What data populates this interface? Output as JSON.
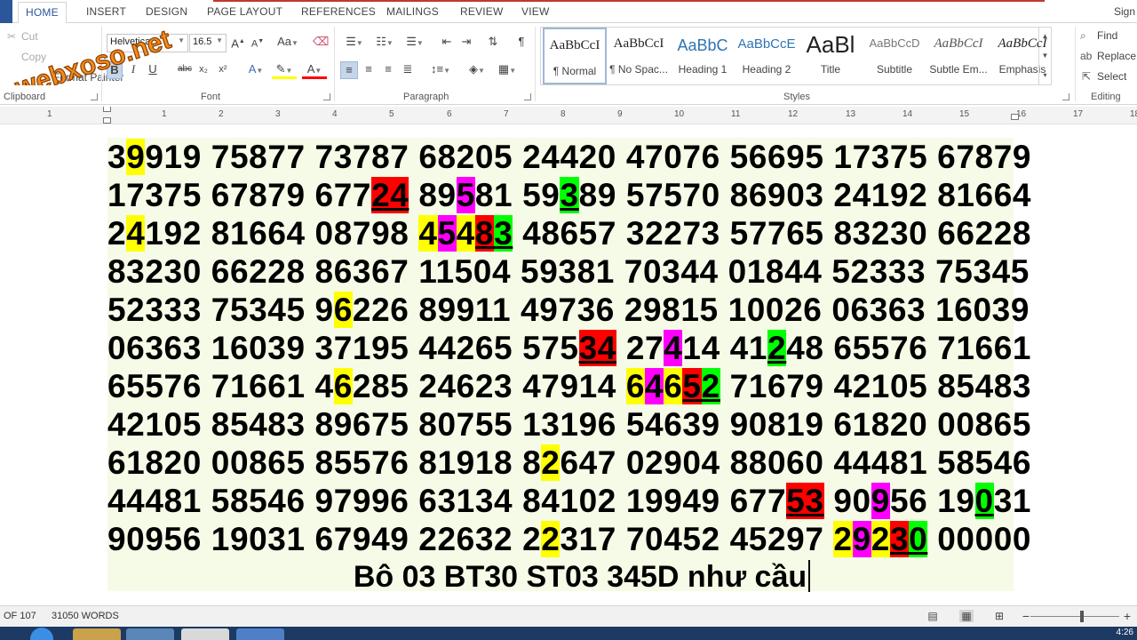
{
  "tabs": [
    "HOME",
    "INSERT",
    "DESIGN",
    "PAGE LAYOUT",
    "REFERENCES",
    "MAILINGS",
    "REVIEW",
    "VIEW"
  ],
  "signin": "Sign",
  "clipboard": {
    "cut": "Cut",
    "copy": "Copy",
    "format_painter": "Format Painter",
    "label": "Clipboard"
  },
  "font": {
    "name": "Helvetica",
    "size": "16.5",
    "label": "Font",
    "buttons": [
      "B",
      "I",
      "U",
      "abc",
      "x₂",
      "x²"
    ]
  },
  "paragraph": {
    "label": "Paragraph"
  },
  "styles": {
    "label": "Styles",
    "items": [
      {
        "preview": "AaBbCcI",
        "name": "¶ Normal"
      },
      {
        "preview": "AaBbCcI",
        "name": "¶ No Spac..."
      },
      {
        "preview": "AaBbC",
        "name": "Heading 1"
      },
      {
        "preview": "AaBbCcE",
        "name": "Heading 2"
      },
      {
        "preview": "AaBl",
        "name": "Title"
      },
      {
        "preview": "AaBbCcD",
        "name": "Subtitle"
      },
      {
        "preview": "AaBbCcI",
        "name": "Subtle Em..."
      },
      {
        "preview": "AaBbCcI",
        "name": "Emphasis"
      }
    ]
  },
  "editing": {
    "find": "Find",
    "replace": "Replace",
    "select": "Select",
    "label": "Editing"
  },
  "watermark": "webxoso.net",
  "ruler": [
    "1",
    "1",
    "2",
    "3",
    "4",
    "5",
    "6",
    "7",
    "8",
    "9",
    "10",
    "11",
    "12",
    "13",
    "14",
    "15",
    "16",
    "17",
    "18"
  ],
  "colors": {
    "yellow": "#ffff00",
    "red": "#ff0000",
    "magenta": "#ff00ff",
    "green": "#00ff00",
    "page": "#f5fbe6",
    "accent": "#2b579a"
  },
  "rows": [
    [
      [
        [
          "3",
          ""
        ],
        [
          "9",
          "y"
        ],
        [
          "919 75877 73787 68205 24420 47076 56695 17375 67879",
          ""
        ]
      ]
    ],
    [
      [
        [
          "17375 67879 677",
          ""
        ],
        [
          "24",
          "r"
        ],
        [
          " 89",
          ""
        ],
        [
          "5",
          "m"
        ],
        [
          "81 59",
          ""
        ],
        [
          "3",
          "g"
        ],
        [
          "89 57570 86903 24192 81664",
          ""
        ]
      ]
    ],
    [
      [
        [
          "2",
          ""
        ],
        [
          "4",
          "y"
        ],
        [
          "192 81664 08798 ",
          ""
        ],
        [
          "4",
          "y"
        ],
        [
          "5",
          "m"
        ],
        [
          "4",
          "y"
        ],
        [
          "8",
          "r"
        ],
        [
          "3",
          "g"
        ],
        [
          " 48657 32273 57765 83230 66228",
          ""
        ]
      ]
    ],
    [
      [
        [
          "83230 66228 86367 11504 59381 70344 01844 52333 75345",
          ""
        ]
      ]
    ],
    [
      [
        [
          "52333 75345 9",
          ""
        ],
        [
          "6",
          "y"
        ],
        [
          "226 89911 49736 29815 10026 06363 16039",
          ""
        ]
      ]
    ],
    [
      [
        [
          "06363 16039 37195 44265 575",
          ""
        ],
        [
          "34",
          "r"
        ],
        [
          " 27",
          ""
        ],
        [
          "4",
          "m"
        ],
        [
          "14 41",
          ""
        ],
        [
          "2",
          "g"
        ],
        [
          "48 65576 71661",
          ""
        ]
      ]
    ],
    [
      [
        [
          "65576 71661 4",
          ""
        ],
        [
          "6",
          "y"
        ],
        [
          "285 24623 47914 ",
          ""
        ],
        [
          "6",
          "y"
        ],
        [
          "4",
          "m"
        ],
        [
          "6",
          "y"
        ],
        [
          "5",
          "r"
        ],
        [
          "2",
          "g"
        ],
        [
          " 71679 42105 85483",
          ""
        ]
      ]
    ],
    [
      [
        [
          "42105 85483 89675 80755 13196 54639 90819 61820 00865",
          ""
        ]
      ]
    ],
    [
      [
        [
          "61820 00865 85576 81918 8",
          ""
        ],
        [
          "2",
          "y"
        ],
        [
          "647 02904 88060 44481 58546",
          ""
        ]
      ]
    ],
    [
      [
        [
          "44481 58546 97996 63134 84102 19949 677",
          ""
        ],
        [
          "53",
          "r"
        ],
        [
          " 90",
          ""
        ],
        [
          "9",
          "m"
        ],
        [
          "56 19",
          ""
        ],
        [
          "0",
          "g"
        ],
        [
          "31",
          ""
        ]
      ]
    ],
    [
      [
        [
          "90956 19031 67949 22632 2",
          ""
        ],
        [
          "2",
          "y"
        ],
        [
          "317 70452 45297 ",
          ""
        ],
        [
          "2",
          "y"
        ],
        [
          "9",
          "m"
        ],
        [
          "2",
          "y"
        ],
        [
          "3",
          "r"
        ],
        [
          "0",
          "g"
        ],
        [
          " 00000",
          ""
        ]
      ]
    ]
  ],
  "footer_text": "Bô 03 BT30 ST03  345D như cầu",
  "status": {
    "page": "OF 107",
    "words": "31050 WORDS"
  },
  "clock": "4:26"
}
